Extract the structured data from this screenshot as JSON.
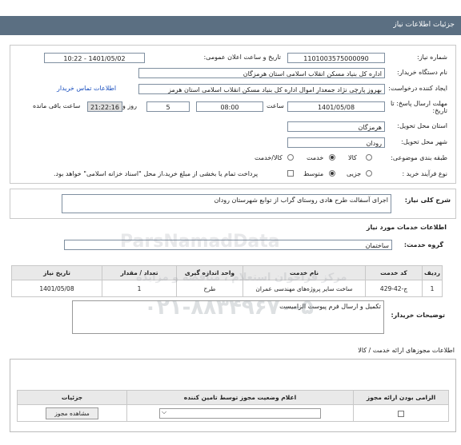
{
  "header": {
    "title": "جزئیات اطلاعات نیاز"
  },
  "form": {
    "need_number_label": "شماره نیاز:",
    "need_number_value": "1101003575000090",
    "announce_label": "تاریخ و ساعت اعلان عمومی:",
    "announce_value": "1401/05/02 - 10:22",
    "buyer_label": "نام دستگاه خریدار:",
    "buyer_value": "اداره کل بنیاد مسکن انقلاب اسلامی استان هرمزگان",
    "creator_label": "ایجاد کننده درخواست:",
    "creator_value": "بهروز  پارچی نژاد جمعدار اموال اداره کل بنیاد مسکن انقلاب اسلامی استان هرمز",
    "contact_link": "اطلاعات تماس خریدار",
    "deadline_label": "مهلت ارسال پاسخ: تا تاریخ:",
    "deadline_date": "1401/05/08",
    "time_label": "ساعت",
    "deadline_time": "08:00",
    "days_value": "5",
    "days_label": "روز و",
    "remaining_value": "21:22:16",
    "remaining_label": "ساعت باقی مانده",
    "province_label": "استان محل تحویل:",
    "province_value": "هرمزگان",
    "city_label": "شهر محل تحویل:",
    "city_value": "رودان",
    "category_label": "طبقه بندی موضوعی:",
    "category_options": [
      "کالا",
      "خدمت",
      "کالا/خدمت"
    ],
    "category_selected": "خدمت",
    "process_label": "نوع فرآیند خرید :",
    "process_options": [
      "جزیی",
      "متوسط"
    ],
    "process_selected": "متوسط",
    "payment_text": "پرداخت تمام یا بخشی از مبلغ خرید،از محل \"اسناد خزانه اسلامی\" خواهد بود."
  },
  "description": {
    "label": "شرح کلی نیاز:",
    "value": "اجرای  آسفالت طرح هادی روستای گراب  از توابع شهرستان رودان"
  },
  "services": {
    "section_title": "اطلاعات خدمات مورد نیاز",
    "group_label": "گروه خدمت:",
    "group_value": "ساختمان",
    "columns": [
      "ردیف",
      "کد خدمت",
      "نام خدمت",
      "واحد اندازه گیری",
      "تعداد / مقدار",
      "تاریخ نیاز"
    ],
    "rows": [
      [
        "1",
        "ج-42-429",
        "ساخت سایر پروژه‌های مهندسی عمران",
        "طرح",
        "1",
        "1401/05/08"
      ]
    ]
  },
  "notes": {
    "label": "توضیحات خریدار:",
    "value": "تکمیل و ارسال فرم پیوست الزامیست"
  },
  "permits": {
    "section_title": "اطلاعات مجوزهای ارائه خدمت / کالا",
    "columns": [
      "الزامی بودن ارائه مجوز",
      "اعلام وضعیت مجوز توسط تامین کننده",
      "جزئیات"
    ],
    "view_button": "مشاهده مجوز"
  },
  "watermark": {
    "line1": "ParsNamadData",
    "line2": "مرکز فراخوان استعلام ، مناقصه و مزایده",
    "phone": "۰۲۱-۸۸۳۴۹۶۷۰-۵"
  }
}
